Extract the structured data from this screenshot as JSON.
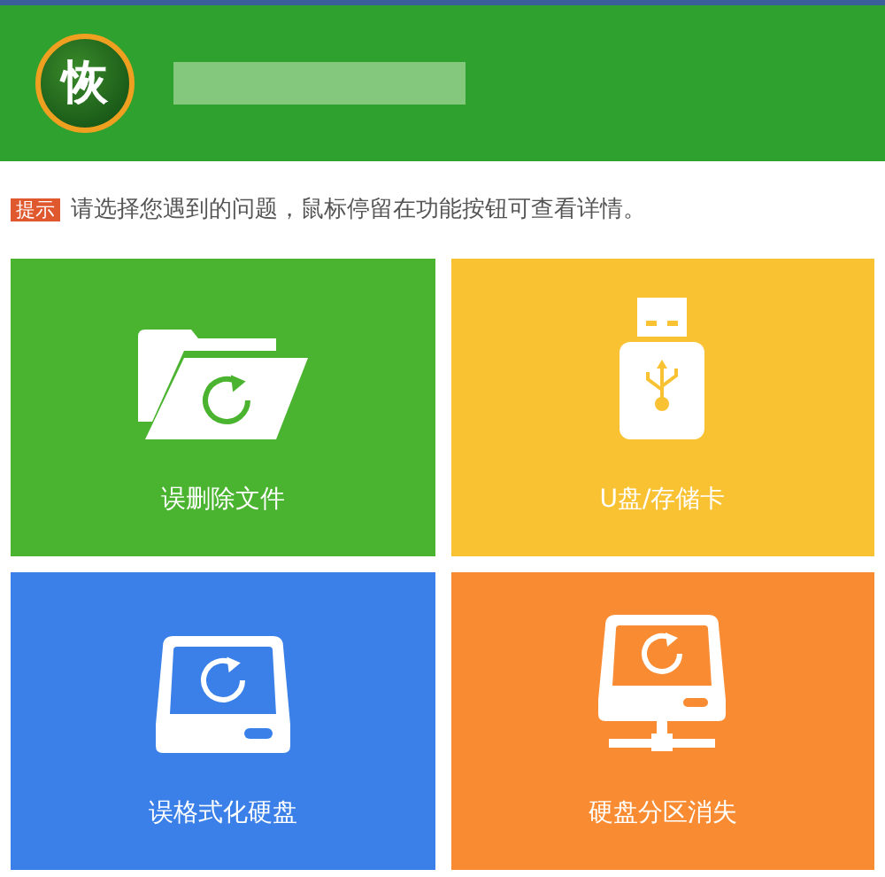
{
  "header": {
    "logo_text": "恢"
  },
  "tip": {
    "badge": "提示",
    "text": "请选择您遇到的问题，鼠标停留在功能按钮可查看详情。"
  },
  "tiles": [
    {
      "kind": "folder",
      "label": "误删除文件",
      "color": "#4ab32f"
    },
    {
      "kind": "usb",
      "label": "U盘/存储卡",
      "color": "#f9c232"
    },
    {
      "kind": "disk",
      "label": "误格式化硬盘",
      "color": "#3b80e8"
    },
    {
      "kind": "partition",
      "label": "硬盘分区消失",
      "color": "#f98c33"
    }
  ]
}
